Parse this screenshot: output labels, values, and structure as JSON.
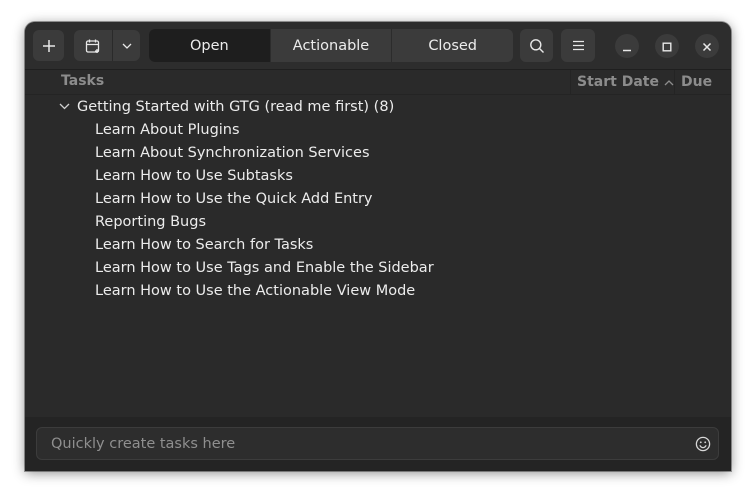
{
  "header": {
    "add_icon": "plus-icon",
    "calendar_icon": "calendar-add-icon",
    "dropdown_icon": "chevron-down-icon",
    "tabs": [
      {
        "label": "Open",
        "active": true
      },
      {
        "label": "Actionable",
        "active": false
      },
      {
        "label": "Closed",
        "active": false
      }
    ],
    "search_icon": "search-icon",
    "menu_icon": "hamburger-menu-icon",
    "window_controls": [
      "minimize-icon",
      "maximize-icon",
      "close-icon"
    ]
  },
  "columns": {
    "tasks": "Tasks",
    "start_date": "Start Date",
    "due": "Due",
    "sort_icon": "chevron-up-icon"
  },
  "tree": {
    "parent": {
      "title": "Getting Started with GTG (read me first) (8)",
      "expanded": true
    },
    "children": [
      "Learn About Plugins",
      "Learn About Synchronization Services",
      "Learn How to Use Subtasks",
      "Learn How to Use the Quick Add Entry",
      "Reporting Bugs",
      "Learn How to Search for Tasks",
      "Learn How to Use Tags and Enable the Sidebar",
      "Learn How to Use the Actionable View Mode"
    ]
  },
  "quick_add": {
    "placeholder": "Quickly create tasks here",
    "value": "",
    "emoji_icon": "emoji-smiley-icon"
  },
  "colors": {
    "window_bg": "#2a2a2a",
    "header_bg": "#2d2d2d",
    "button_bg": "#3b3b3b",
    "active_tab_bg": "#1e1e1e",
    "text": "#ececec",
    "muted_text": "#8c8c8c"
  }
}
